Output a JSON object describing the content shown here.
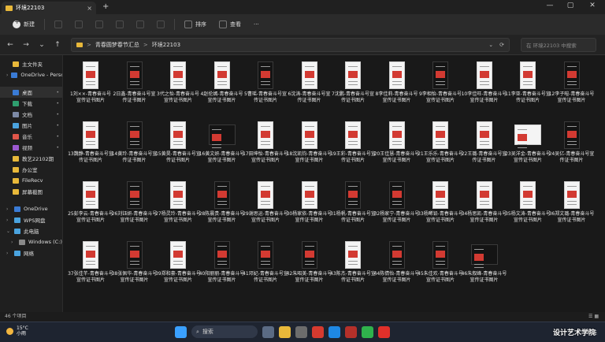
{
  "window": {
    "tab_title": "环境22103",
    "new_tab_glyph": "+",
    "close_glyph": "×",
    "min_glyph": "—",
    "max_glyph": "▢",
    "winclose_glyph": "✕"
  },
  "toolbar": {
    "new_label": "新建",
    "sort_label": "排序",
    "view_label": "查看",
    "more_label": "···"
  },
  "address": {
    "back": "←",
    "forward": "→",
    "up_history": "⌄",
    "up": "↑",
    "crumbs": [
      "青春圆梦春节汇总",
      "环境22103"
    ],
    "separator": ">",
    "refresh": "⟳",
    "dropdown": "⌄",
    "search_placeholder": "在 环境22103 中搜索"
  },
  "sidebar": {
    "home": "主文件夹",
    "onedrive_personal": "OneDrive - Perso",
    "quick": [
      {
        "label": "桌面",
        "color": "#3a7bd5"
      },
      {
        "label": "下载",
        "color": "#2f9e6f"
      },
      {
        "label": "文档",
        "color": "#7d8aa6"
      },
      {
        "label": "图片",
        "color": "#4aa3df"
      },
      {
        "label": "音乐",
        "color": "#e0564a"
      },
      {
        "label": "视频",
        "color": "#9b59d0"
      },
      {
        "label": "教艺22102期",
        "color": "#e8b83a"
      },
      {
        "label": "办公室",
        "color": "#e8b83a"
      },
      {
        "label": "FileRecv",
        "color": "#e8b83a"
      },
      {
        "label": "屏幕截图",
        "color": "#e8b83a"
      }
    ],
    "onedrive": "OneDrive",
    "wps": "WPS网盘",
    "this_pc": "此电脑",
    "windows_c": "Windows (C:)",
    "network": "网络",
    "pin_glyph": "📌"
  },
  "files": [
    {
      "name": "1刘××-青春奋斗号宣传证书图片",
      "dark": false
    },
    {
      "name": "2日鑫-青春奋斗号宣传证书图片",
      "dark": true
    },
    {
      "name": "3代之怡-青春奋斗号宣传证书图片",
      "dark": false
    },
    {
      "name": "4赵伦嫣-青春奋斗号宣传证书图片",
      "dark": false
    },
    {
      "name": "5曹瑶-青春奋斗号宣传证书图片",
      "dark": true
    },
    {
      "name": "6沈涛-青春奋斗号宣传证书图片",
      "dark": false
    },
    {
      "name": "7沈鹏-青春奋斗号宣传证书图片",
      "dark": false
    },
    {
      "name": "8李佳莉-青春奋斗号宣传证书图片",
      "dark": false
    },
    {
      "name": "9李相怡-青春奋斗号宣传证书图片",
      "dark": true
    },
    {
      "name": "10李佳旺-青春奋斗号宣传证书图片",
      "dark": false
    },
    {
      "name": "11李亚-青春奋斗号宣传证书图片",
      "dark": false
    },
    {
      "name": "12李子暄-青春奋斗号宣传证书图片",
      "dark": true
    },
    {
      "name": "13魏静-青春奋斗号宣传证书图片",
      "dark": false
    },
    {
      "name": "14黄玲-青春奋斗号宣传证书图片",
      "dark": true
    },
    {
      "name": "15黄昊-青春奋斗号宣传证书图片",
      "dark": false
    },
    {
      "name": "16黄文妍-青春奋斗号宣传证书图片",
      "dark": true
    },
    {
      "name": "17田坤怡-青春奋斗号宣传证书图片",
      "dark": false
    },
    {
      "name": "18沈凯钧-青春奋斗号宣传证书图片",
      "dark": false
    },
    {
      "name": "19王彩-青春奋斗号宣传证书图片",
      "dark": false
    },
    {
      "name": "20王佳慧-青春奋斗号宣传证书图片",
      "dark": false
    },
    {
      "name": "21王乐乐-青春奋斗号宣传证书图片",
      "dark": false
    },
    {
      "name": "22王璐-青春奋斗号宣传证书图片",
      "dark": false
    },
    {
      "name": "23吴洋金-青春奋斗号宣传证书图片",
      "dark": false
    },
    {
      "name": "24吴亿-青春奋斗号宣传证书图片",
      "dark": true
    },
    {
      "name": "25彭李云-青春奋斗号宣传证书图片",
      "dark": false
    },
    {
      "name": "26刘钰妍-青春奋斗号宣传证书图片",
      "dark": true
    },
    {
      "name": "27杨灵玲-青春奋斗号宣传证书图片",
      "dark": false
    },
    {
      "name": "28陈晨贵-青春奋斗号宣传证书图片",
      "dark": true
    },
    {
      "name": "29谢思运-青春奋斗号宣传证书图片",
      "dark": false
    },
    {
      "name": "30杨家依-青春奋斗号宣传证书图片",
      "dark": false
    },
    {
      "name": "31杨帆-青春奋斗号宣传证书图片",
      "dark": true
    },
    {
      "name": "32杨家宁-青春奋斗号宣传证书图片",
      "dark": true
    },
    {
      "name": "33杨晞铅-青春奋斗号宣传证书图片",
      "dark": false
    },
    {
      "name": "34杨思凯-青春奋斗号宣传证书图片",
      "dark": false
    },
    {
      "name": "35杨文涛-青春奋斗号宣传证书图片",
      "dark": false
    },
    {
      "name": "36郑文璐-青春奋斗号宣传证书图片",
      "dark": false
    },
    {
      "name": "37张佳芊-青春奋斗号宣传证书图片",
      "dark": false
    },
    {
      "name": "38张佩华-青春奋斗号宣传证书图片",
      "dark": true
    },
    {
      "name": "39郑和豪-青春奋斗号宣传证书图片",
      "dark": false
    },
    {
      "name": "40阳丽丽-青春奋斗号宣传证书图片",
      "dark": true
    },
    {
      "name": "41邓妃-青春奋斗号宣传证书图片",
      "dark": true
    },
    {
      "name": "42朱昭美-青春奋斗号宣传证书图片",
      "dark": true
    },
    {
      "name": "43陈杰-青春奋斗号宣传证书图片",
      "dark": false
    },
    {
      "name": "44陈倩怡-青春奋斗号宣传证书图片",
      "dark": true
    },
    {
      "name": "45朱佳欢-青春奋斗号宣传证书图片",
      "dark": true
    },
    {
      "name": "46朱叙峰-青春奋斗号宣传证书图片",
      "dark": true
    }
  ],
  "status": {
    "count": "46 个项目",
    "views": "☰ ▦"
  },
  "taskbar": {
    "temp": "15°C",
    "weather": "小雨",
    "search": "搜索",
    "tray": "∧  英  ",
    "watermark": "设计艺术学院"
  }
}
